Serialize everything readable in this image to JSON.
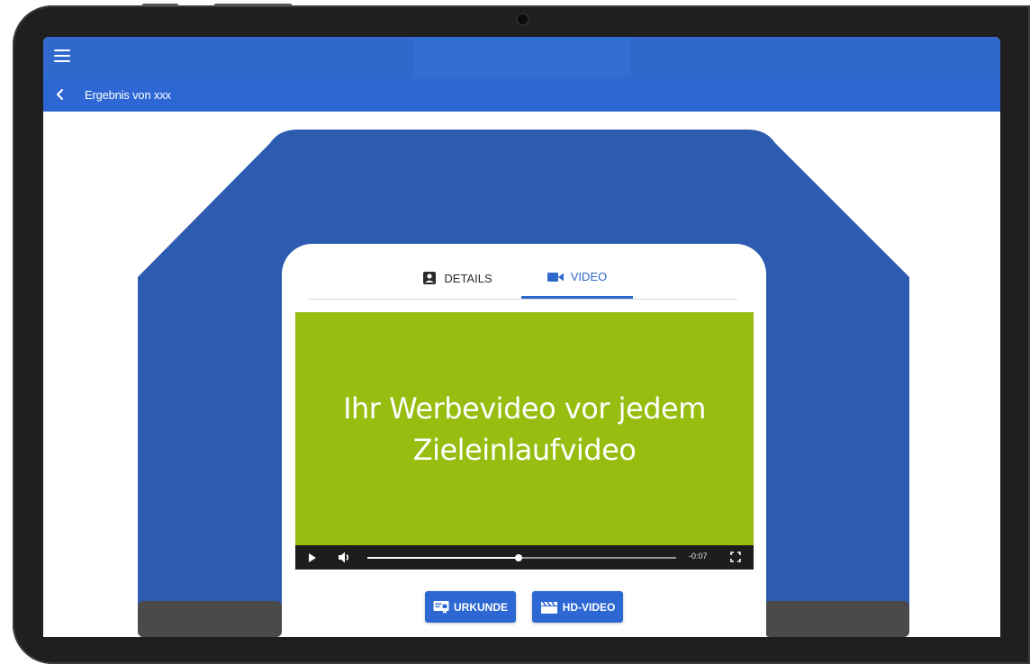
{
  "appbar": {
    "menu_icon": "hamburger-menu-icon"
  },
  "subbar": {
    "back_icon": "chevron-left-icon",
    "title": "Ergebnis von xxx"
  },
  "tabs": [
    {
      "label": "DETAILS",
      "icon": "account-box-icon",
      "active": false
    },
    {
      "label": "VIDEO",
      "icon": "videocam-icon",
      "active": true
    }
  ],
  "video": {
    "text_line1": "Ihr Werbevideo vor jedem",
    "text_line2": "Zieleinlaufvideo",
    "progress": 0.49,
    "time_remaining": "-0:07",
    "background_color": "#96bd0f"
  },
  "actions": {
    "urkunde_label": "URKUNDE",
    "hdvideo_label": "HD-VIDEO"
  },
  "colors": {
    "primary": "#2f69cc",
    "arch_blue": "#2c5bb0",
    "arch_foot": "#4a4a4a"
  }
}
